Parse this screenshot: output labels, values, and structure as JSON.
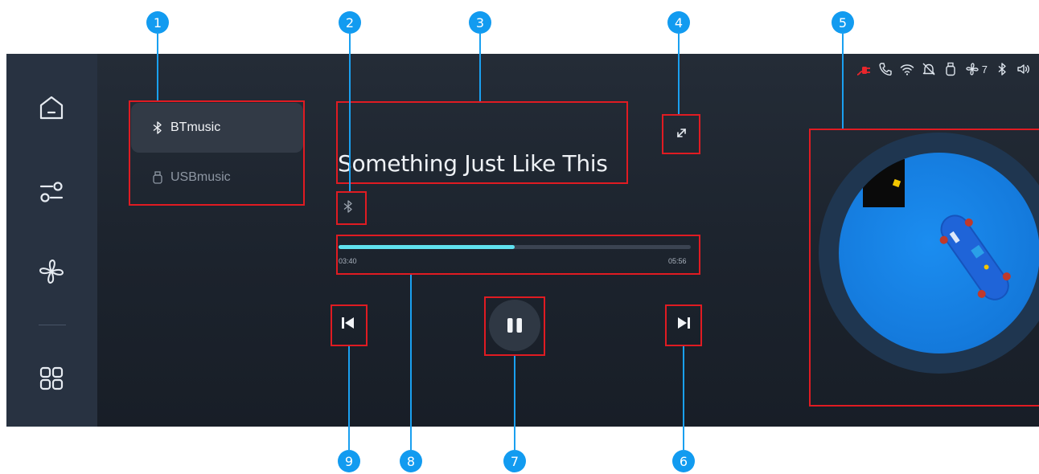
{
  "sources": {
    "bt": {
      "label": "BTmusic",
      "icon": "bluetooth-icon"
    },
    "usb": {
      "label": "USBmusic",
      "icon": "usb-icon"
    }
  },
  "sidebar": {
    "items": [
      {
        "icon": "home-icon"
      },
      {
        "icon": "settings-sliders-icon"
      },
      {
        "icon": "fan-icon"
      },
      {
        "icon": "apps-grid-icon"
      }
    ]
  },
  "status_bar": {
    "icons": [
      "charging-plug-icon",
      "phone-icon",
      "wifi-icon",
      "mute-bell-icon",
      "usb-icon",
      "fan-icon",
      "bluetooth-icon",
      "volume-icon"
    ],
    "fan_level": "7",
    "charging_color": "#e8262c"
  },
  "player": {
    "title": "Something Just Like This",
    "source_icon": "bluetooth-icon",
    "progress": 0.5,
    "current_time": "03:40",
    "total_time": "05:56",
    "accent": "#5fe2f0"
  },
  "annotations": {
    "markers": [
      "1",
      "2",
      "3",
      "4",
      "5",
      "6",
      "7",
      "8",
      "9"
    ],
    "box_color": "#e01b22",
    "marker_color": "#129bf0"
  }
}
